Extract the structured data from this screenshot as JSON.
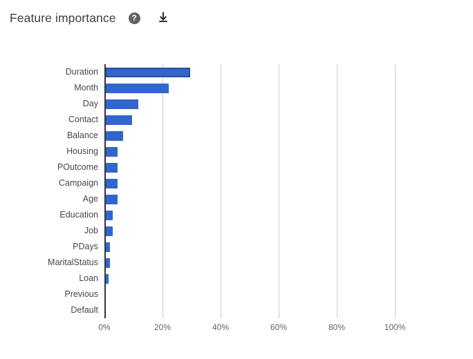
{
  "header": {
    "title": "Feature importance",
    "help_icon": "help-icon",
    "help_glyph": "?",
    "download_icon": "download-icon"
  },
  "colors": {
    "bar": "#3366CC",
    "bar_selected_outline": "#2A4F9E",
    "axis": "#333333",
    "gridline": "#CCCCCC",
    "label_text": "#444746",
    "tick_text": "#5F6368",
    "title_text": "#3C4043",
    "background": "#FFFFFF"
  },
  "chart_data": {
    "type": "bar",
    "orientation": "horizontal",
    "title": "Feature importance",
    "xlabel": "",
    "ylabel": "",
    "xlim": [
      0,
      100
    ],
    "grid": true,
    "legend": false,
    "value_suffix": "%",
    "xticks": [
      "0%",
      "20%",
      "40%",
      "60%",
      "80%",
      "100%"
    ],
    "xtick_values": [
      0,
      20,
      40,
      60,
      80,
      100
    ],
    "categories": [
      "Duration",
      "Month",
      "Day",
      "Contact",
      "Balance",
      "Housing",
      "POutcome",
      "Campaign",
      "Age",
      "Education",
      "Job",
      "PDays",
      "MaritalStatus",
      "Loan",
      "Previous",
      "Default"
    ],
    "values": [
      29.4,
      21.9,
      11.4,
      9.3,
      6.1,
      4.4,
      4.3,
      4.3,
      4.3,
      2.6,
      2.6,
      1.7,
      1.7,
      1.2,
      0.2,
      0
    ],
    "selected_category": "Duration"
  }
}
